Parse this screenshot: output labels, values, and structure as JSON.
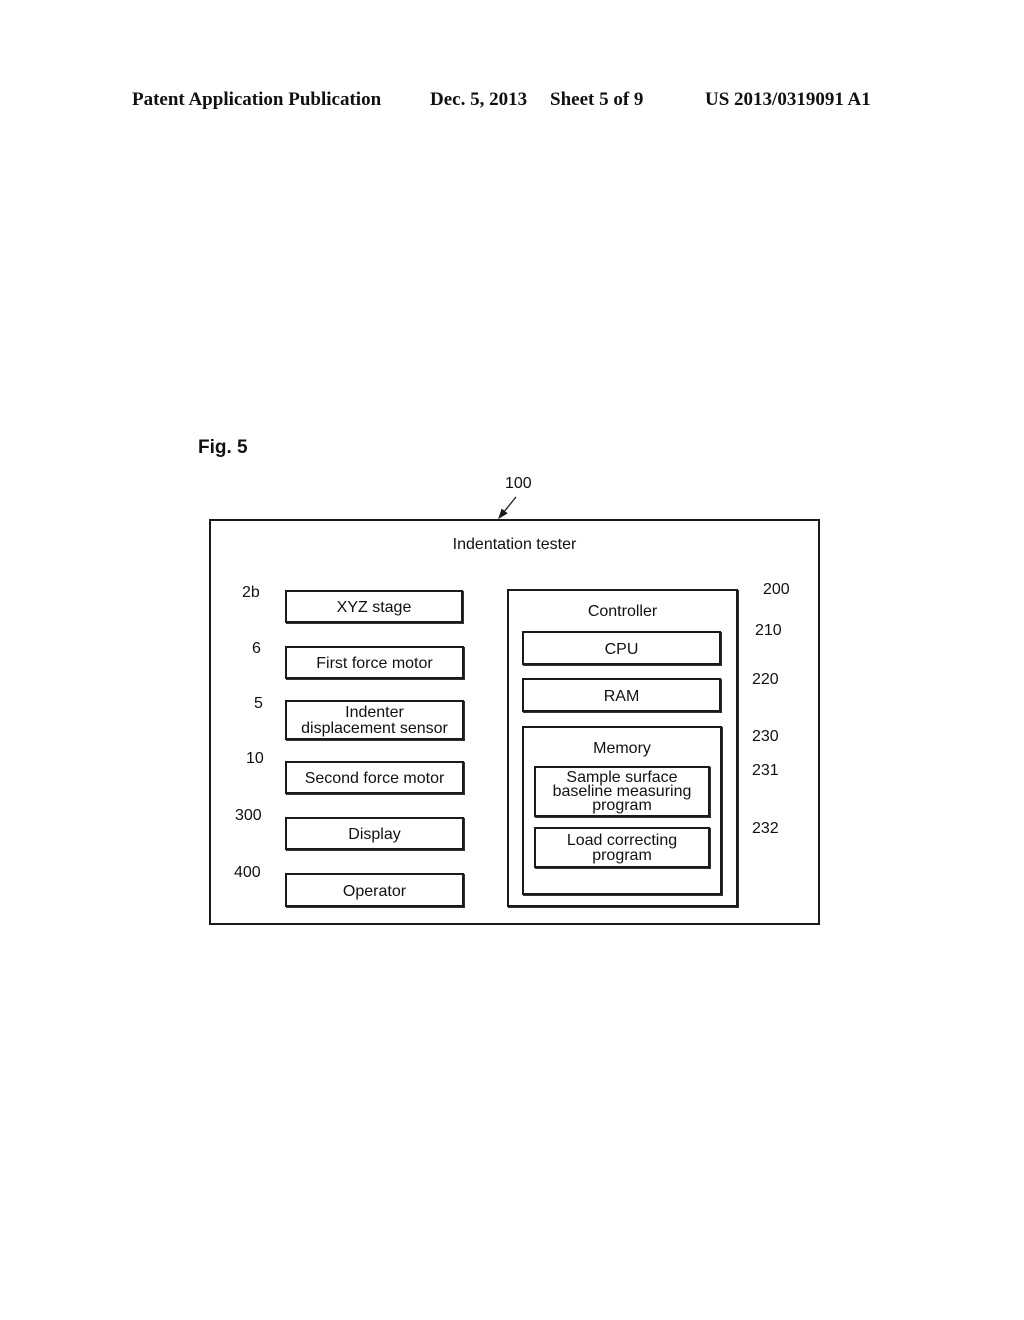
{
  "header": {
    "publication": "Patent Application Publication",
    "date": "Dec. 5, 2013",
    "sheet": "Sheet 5 of 9",
    "number": "US 2013/0319091 A1"
  },
  "figure": {
    "label": "Fig. 5",
    "system": {
      "ref": "100",
      "title": "Indentation tester"
    },
    "devices": [
      {
        "ref": "2b",
        "label": "XYZ stage"
      },
      {
        "ref": "6",
        "label": "First force motor"
      },
      {
        "ref": "5",
        "label_line1": "Indenter",
        "label_line2": "displacement sensor"
      },
      {
        "ref": "10",
        "label": "Second force motor"
      },
      {
        "ref": "300",
        "label": "Display"
      },
      {
        "ref": "400",
        "label": "Operator"
      }
    ],
    "controller": {
      "ref": "200",
      "title": "Controller",
      "cpu": {
        "ref": "210",
        "label": "CPU"
      },
      "ram": {
        "ref": "220",
        "label": "RAM"
      },
      "memory": {
        "ref": "230",
        "title": "Memory",
        "programs": [
          {
            "ref": "231",
            "line1": "Sample surface",
            "line2": "baseline measuring",
            "line3": "program"
          },
          {
            "ref": "232",
            "line1": "Load correcting",
            "line2": "program"
          }
        ]
      }
    }
  }
}
